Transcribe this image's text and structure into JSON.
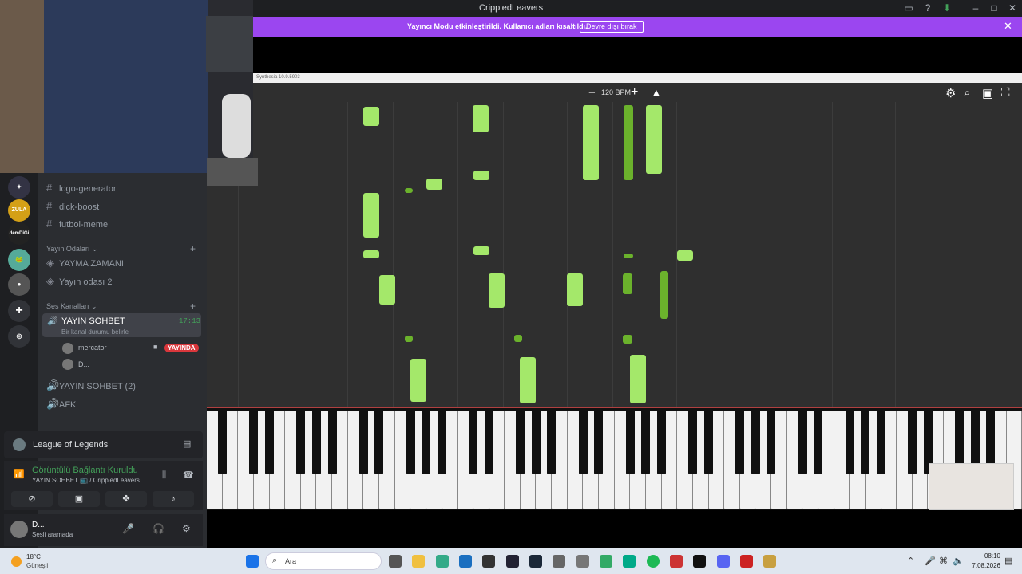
{
  "window": {
    "title": "CrippledLeavers"
  },
  "banner": {
    "text": "Yayıncı Modu etkinleştirildi. Kullanıcı adları kısaltıldı.",
    "button": "Devre dışı bırak"
  },
  "synthesia": {
    "title": "Synthesia 10.9.5903",
    "bpm": "120 BPM"
  },
  "notes": [
    {
      "lane": 0,
      "start": 0.03,
      "len": 0.06,
      "dark": false
    },
    {
      "lane": 1,
      "start": 0.03,
      "len": 0.08,
      "dark": false
    },
    {
      "lane": 2,
      "start": 0.02,
      "len": 0.24,
      "dark": false
    },
    {
      "lane": 3,
      "start": 0.02,
      "len": 0.24,
      "dark": true
    },
    {
      "lane": 4,
      "start": 0.02,
      "len": 0.22,
      "dark": false
    }
  ],
  "channels": {
    "text": [
      "logo-generator",
      "dick-boost",
      "futbol-meme"
    ],
    "stage_category": "Yayın Odaları",
    "stages": [
      "YAYMA ZAMANI",
      "Yayın odası 2"
    ],
    "voice_category": "Ses Kanalları",
    "active_voice": {
      "name": "YAYIN SOHBET",
      "time": "17:13",
      "status": "Bir kanal durumu belirle"
    },
    "users": [
      {
        "name": "mercator",
        "live": "YAYINDA"
      },
      {
        "name": "D..."
      }
    ],
    "other_voice": [
      "YAYIN SOHBET (2)",
      "AFK"
    ]
  },
  "activity": {
    "game": "League of Legends"
  },
  "voice_panel": {
    "title": "Görüntülü Bağlantı Kuruldu",
    "sub": "YAYIN SOHBET 📺 / CrippledLeavers"
  },
  "user": {
    "name": "D...",
    "status": "Sesli aramada"
  },
  "servers": [
    {
      "label": "ZULA",
      "color": "#d4a017"
    },
    {
      "label": "demDiGi",
      "color": "#222"
    }
  ],
  "taskbar": {
    "temp": "18°C",
    "weather": "Güneşli",
    "search": "Ara",
    "time": "08:10",
    "date": "7.08.2026"
  }
}
